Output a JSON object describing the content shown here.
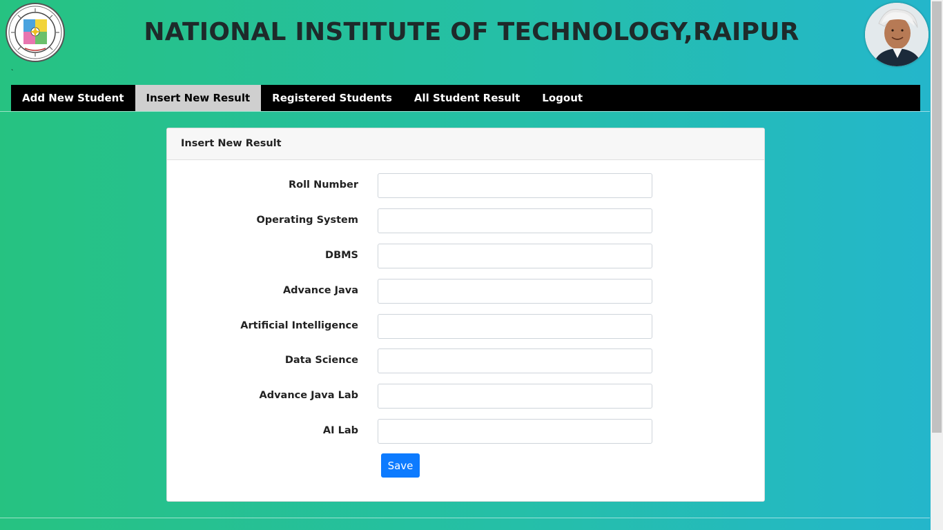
{
  "header": {
    "title": "NATIONAL INSTITUTE OF TECHNOLOGY,RAIPUR",
    "stray_mark": "`"
  },
  "nav": {
    "items": [
      {
        "label": "Add New Student",
        "active": false
      },
      {
        "label": "Insert New Result",
        "active": true
      },
      {
        "label": "Registered Students",
        "active": false
      },
      {
        "label": "All Student Result",
        "active": false
      },
      {
        "label": "Logout",
        "active": false
      }
    ]
  },
  "form": {
    "card_title": "Insert New Result",
    "fields": [
      {
        "label": "Roll Number",
        "value": ""
      },
      {
        "label": "Operating System",
        "value": ""
      },
      {
        "label": "DBMS",
        "value": ""
      },
      {
        "label": "Advance Java",
        "value": ""
      },
      {
        "label": "Artificial Intelligence",
        "value": ""
      },
      {
        "label": "Data Science",
        "value": ""
      },
      {
        "label": "Advance Java Lab",
        "value": ""
      },
      {
        "label": "AI Lab",
        "value": ""
      }
    ],
    "save_label": "Save"
  },
  "colors": {
    "accent": "#0d7bff",
    "navbar": "#000000",
    "active_tab": "#cfcfcf",
    "bg_start": "#26c281",
    "bg_end": "#24b6cc"
  },
  "icons": {
    "left_logo": "institute-emblem-icon",
    "right_avatar": "portrait-avatar"
  }
}
